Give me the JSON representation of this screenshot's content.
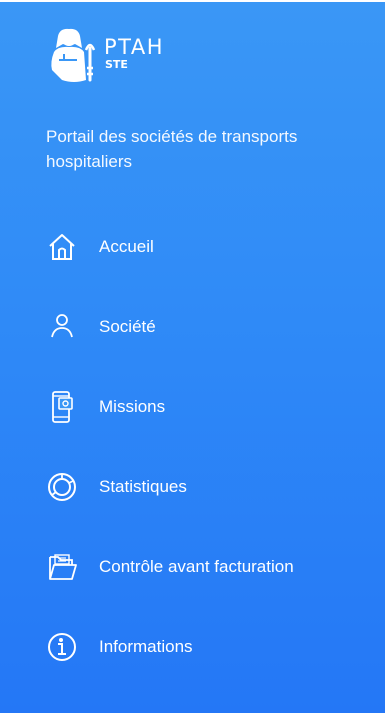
{
  "brand": {
    "title": "PTAH",
    "subtitle": "STE",
    "logo_icon": "pharaoh-logo-icon"
  },
  "tagline": "Portail des sociétés de transports hospitaliers",
  "nav": {
    "items": [
      {
        "label": "Accueil",
        "icon": "home-icon"
      },
      {
        "label": "Société",
        "icon": "user-icon"
      },
      {
        "label": "Missions",
        "icon": "mobile-phone-icon"
      },
      {
        "label": "Statistiques",
        "icon": "donut-chart-icon"
      },
      {
        "label": "Contrôle avant facturation",
        "icon": "folder-icon"
      },
      {
        "label": "Informations",
        "icon": "info-icon"
      }
    ]
  },
  "colors": {
    "sidebar_top": "#3a97f6",
    "sidebar_bottom": "#2477f6",
    "text": "#ffffff"
  }
}
